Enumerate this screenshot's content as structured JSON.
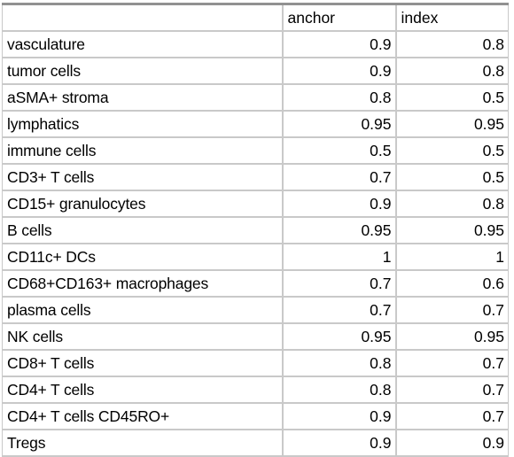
{
  "table": {
    "columns": [
      {
        "key": "label",
        "header": ""
      },
      {
        "key": "anchor",
        "header": "anchor"
      },
      {
        "key": "index",
        "header": "index"
      }
    ],
    "rows": [
      {
        "label": "vasculature",
        "anchor": "0.9",
        "index": "0.8"
      },
      {
        "label": "tumor cells",
        "anchor": "0.9",
        "index": "0.8"
      },
      {
        "label": "aSMA+ stroma",
        "anchor": "0.8",
        "index": "0.5"
      },
      {
        "label": "lymphatics",
        "anchor": "0.95",
        "index": "0.95"
      },
      {
        "label": "immune cells",
        "anchor": "0.5",
        "index": "0.5"
      },
      {
        "label": "CD3+ T cells",
        "anchor": "0.7",
        "index": "0.5"
      },
      {
        "label": "CD15+ granulocytes",
        "anchor": "0.9",
        "index": "0.8"
      },
      {
        "label": "B cells",
        "anchor": "0.95",
        "index": "0.95"
      },
      {
        "label": "CD11c+ DCs",
        "anchor": "1",
        "index": "1"
      },
      {
        "label": "CD68+CD163+ macrophages",
        "anchor": "0.7",
        "index": "0.6"
      },
      {
        "label": "plasma cells",
        "anchor": "0.7",
        "index": "0.7"
      },
      {
        "label": "NK cells",
        "anchor": "0.95",
        "index": "0.95"
      },
      {
        "label": "CD8+ T cells",
        "anchor": "0.8",
        "index": "0.7"
      },
      {
        "label": "CD4+ T cells",
        "anchor": "0.8",
        "index": "0.7"
      },
      {
        "label": "CD4+ T cells CD45RO+",
        "anchor": "0.9",
        "index": "0.7"
      },
      {
        "label": "Tregs",
        "anchor": "0.9",
        "index": "0.9"
      }
    ]
  },
  "colors": {
    "grid_line": "#c9c9c9",
    "top_border": "#919191",
    "text": "#000000",
    "background": "#ffffff"
  }
}
